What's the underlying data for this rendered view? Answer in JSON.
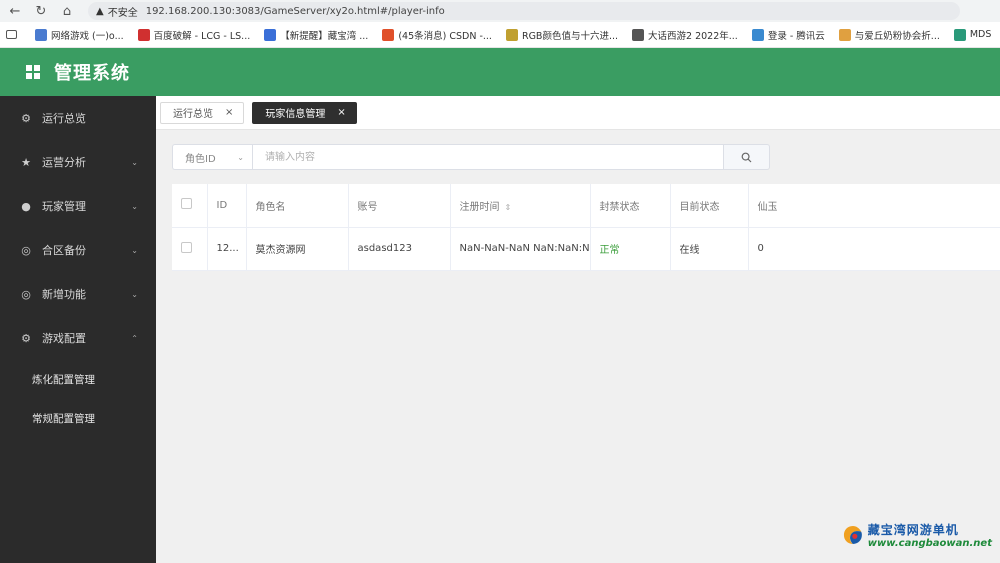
{
  "browser": {
    "insecure_label": "不安全",
    "url": "192.168.200.130:3083/GameServer/xy2o.html#/player-info"
  },
  "bookmarks": [
    {
      "label": "网络游戏 (一)o...",
      "color": "#4a7bd0"
    },
    {
      "label": "百度破解 - LCG - LS...",
      "color": "#d03030"
    },
    {
      "label": "【新提醒】藏宝湾 ...",
      "color": "#3a6fd8"
    },
    {
      "label": "(45条消息) CSDN -...",
      "color": "#e0502a"
    },
    {
      "label": "RGB颜色值与十六进...",
      "color": "#c0a030"
    },
    {
      "label": "大话西游2 2022年...",
      "color": "#555555"
    },
    {
      "label": "登录 - 腾讯云",
      "color": "#3a8ad0"
    },
    {
      "label": "与爱丘奶粉协会折...",
      "color": "#e0a040"
    },
    {
      "label": "MDS",
      "color": "#2a9a7a"
    }
  ],
  "app": {
    "title": "管理系统"
  },
  "sidebar": {
    "items": [
      {
        "label": "运行总览",
        "icon": "gear-icon",
        "arrow": ""
      },
      {
        "label": "运营分析",
        "icon": "star-icon",
        "arrow": "⌄"
      },
      {
        "label": "玩家管理",
        "icon": "user-icon",
        "arrow": "⌄"
      },
      {
        "label": "合区备份",
        "icon": "eye-icon",
        "arrow": "⌄"
      },
      {
        "label": "新增功能",
        "icon": "eye-icon",
        "arrow": "⌄"
      },
      {
        "label": "游戏配置",
        "icon": "gear-icon",
        "arrow": "⌃"
      }
    ],
    "sub_items": [
      {
        "label": "炼化配置管理"
      },
      {
        "label": "常规配置管理"
      }
    ]
  },
  "tabs": [
    {
      "label": "运行总览",
      "close": "×",
      "active": false
    },
    {
      "label": "玩家信息管理",
      "close": "×",
      "active": true
    }
  ],
  "search": {
    "select_value": "角色ID",
    "placeholder": "请输入内容",
    "value": ""
  },
  "table": {
    "headers": [
      "ID",
      "角色名",
      "账号",
      "注册时间",
      "封禁状态",
      "目前状态",
      "仙玉"
    ],
    "rows": [
      {
        "id": "12...",
        "name": "莫杰资源网",
        "account": "asdasd123",
        "reg_time": "NaN-NaN-NaN NaN:NaN:NaN",
        "ban_status": "正常",
        "status": "在线",
        "xianyu": "0"
      }
    ]
  },
  "watermark": {
    "title": "藏宝湾网游单机",
    "url": "www.cangbaowan.net"
  }
}
